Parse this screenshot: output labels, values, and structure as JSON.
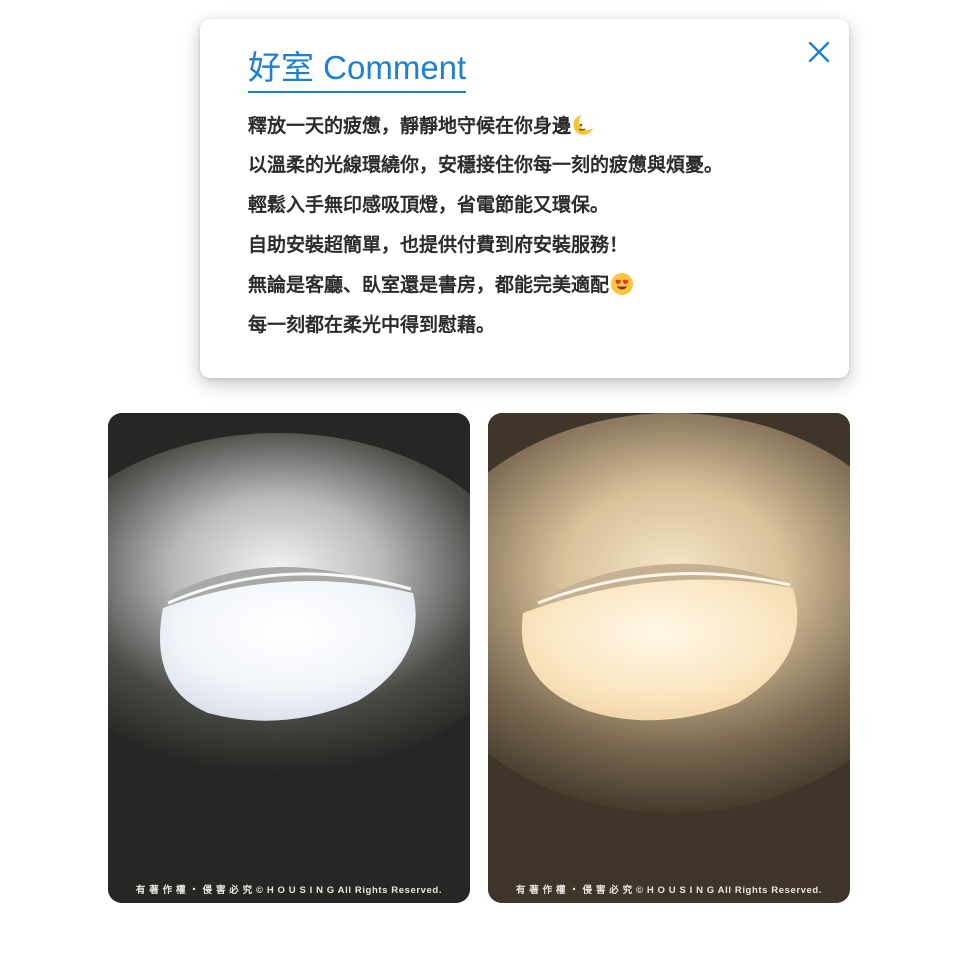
{
  "comment_card": {
    "title": "好室 Comment",
    "close_icon": "close-icon",
    "lines": [
      "釋放一天的疲憊，靜靜地守候在你身邊",
      "以溫柔的光線環繞你，安穩接住你每一刻的疲憊與煩憂。",
      "輕鬆入手無印感吸頂燈，省電節能又環保。",
      "自助安裝超簡單，也提供付費到府安裝服務！",
      "無論是客廳、臥室還是書房，都能完美適配",
      "每一刻都在柔光中得到慰藉。"
    ],
    "line_emojis": [
      "crescent-moon-face-emoji",
      "",
      "",
      "",
      "heart-eyes-emoji",
      ""
    ],
    "accent_color": "#1f7fd4"
  },
  "photos": [
    {
      "name": "cool-white-light",
      "copyright": "有 著 作 權 ・ 侵 害 必 究 © H O U S I N G All Rights Reserved.",
      "glow_color": "#e9eef5"
    },
    {
      "name": "warm-white-light",
      "copyright": "有 著 作 權 ・ 侵 害 必 究 © H O U S I N G All Rights Reserved.",
      "glow_color": "#f3dfb7"
    }
  ]
}
